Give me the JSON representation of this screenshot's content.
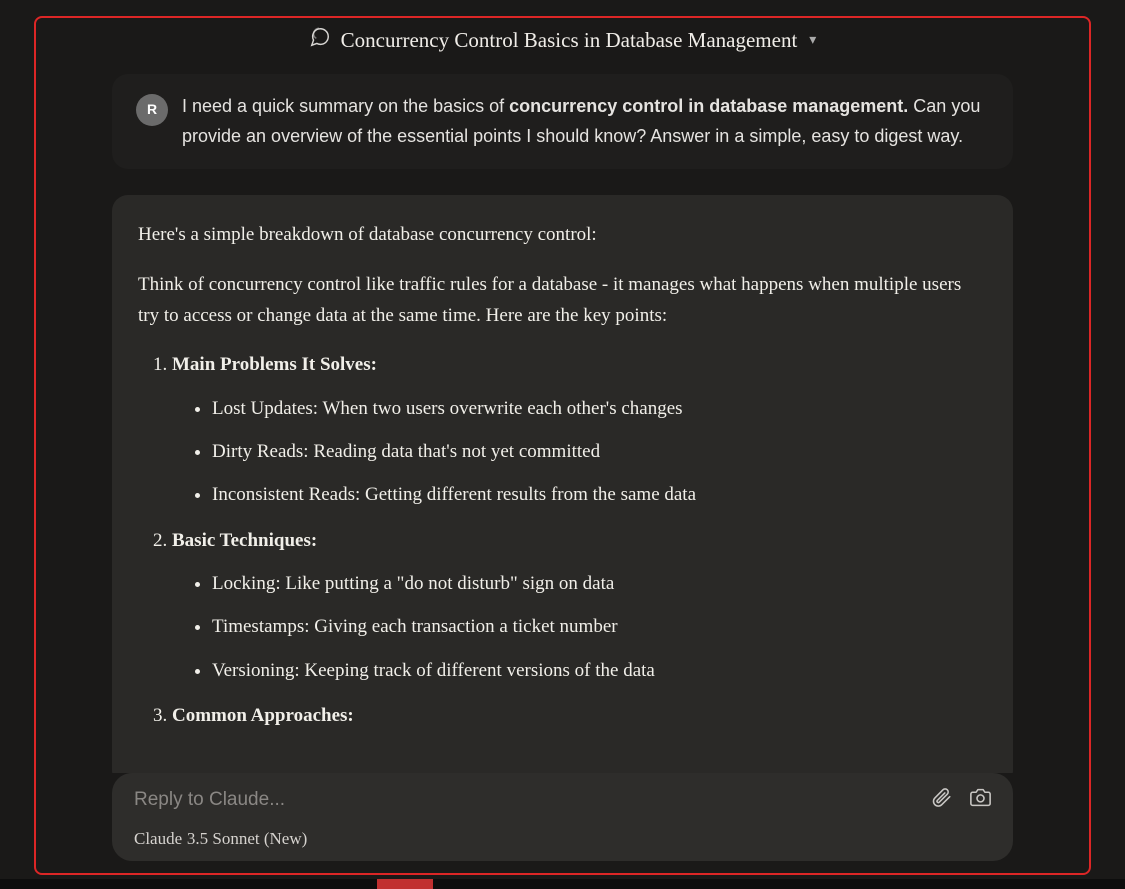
{
  "header": {
    "title": "Concurrency Control Basics in Database Management"
  },
  "user": {
    "avatar_initial": "R",
    "prefix": "I need a quick summary on the basics of ",
    "bold": "concurrency control in database management.",
    "suffix": " Can you provide an overview of the essential points I should know? Answer in a simple, easy to digest way."
  },
  "assistant": {
    "intro1": "Here's a simple breakdown of database concurrency control:",
    "intro2": "Think of concurrency control like traffic rules for a database - it manages what happens when multiple users try to access or change data at the same time. Here are the key points:",
    "sections": [
      {
        "title": "Main Problems It Solves:",
        "items": [
          "Lost Updates: When two users overwrite each other's changes",
          "Dirty Reads: Reading data that's not yet committed",
          "Inconsistent Reads: Getting different results from the same data"
        ]
      },
      {
        "title": "Basic Techniques:",
        "items": [
          "Locking: Like putting a \"do not disturb\" sign on data",
          "Timestamps: Giving each transaction a ticket number",
          "Versioning: Keeping track of different versions of the data"
        ]
      },
      {
        "title": "Common Approaches:",
        "items": []
      }
    ]
  },
  "composer": {
    "placeholder": "Reply to Claude...",
    "model_label": "Claude",
    "model_name": "3.5 Sonnet (New)"
  }
}
